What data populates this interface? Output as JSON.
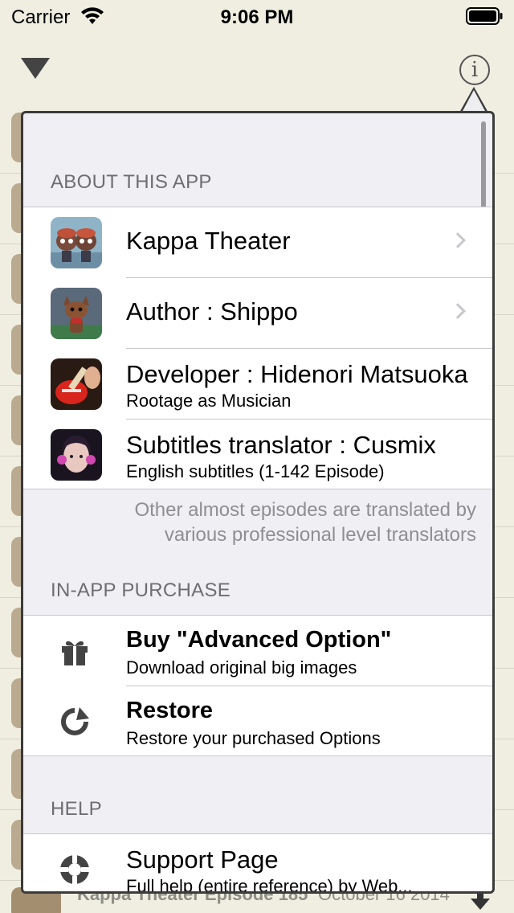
{
  "status_bar": {
    "carrier": "Carrier",
    "time": "9:06 PM"
  },
  "background": {
    "bottom_row": {
      "title": "Kappa Theater Episode 185",
      "date": "October 16 2014"
    }
  },
  "popover": {
    "about_section": {
      "header": "ABOUT THIS APP",
      "items": [
        {
          "title": "Kappa Theater",
          "subtitle": "",
          "thumb": "kappa-figures"
        },
        {
          "title": "Author : Shippo",
          "subtitle": "",
          "thumb": "brown-fox-figure"
        },
        {
          "title": "Developer : Hidenori Matsuoka",
          "subtitle": "Rootage as Musician",
          "thumb": "red-guitar"
        },
        {
          "title": "Subtitles translator : Cusmix",
          "subtitle": "English subtitles (1-142 Episode)",
          "thumb": "person-with-headphones"
        }
      ],
      "footer_line1": "Other almost episodes are translated by",
      "footer_line2": "various professional level translators"
    },
    "iap_section": {
      "header": "IN-APP PURCHASE",
      "items": [
        {
          "title": "Buy \"Advanced Option\"",
          "subtitle": "Download original big images",
          "icon": "gift-icon"
        },
        {
          "title": "Restore",
          "subtitle": "Restore your purchased Options",
          "icon": "restore-icon"
        }
      ]
    },
    "help_section": {
      "header": "HELP",
      "items": [
        {
          "title": "Support Page",
          "subtitle": "Full help (entire reference) by Web...",
          "icon": "lifebuoy-icon"
        }
      ]
    }
  },
  "colors": {
    "background": "#efeee1",
    "popover_border": "#3b3b3b",
    "grouped_bg": "#efeff4",
    "section_header": "#6d6d72",
    "footer_text": "#8e8e93"
  }
}
